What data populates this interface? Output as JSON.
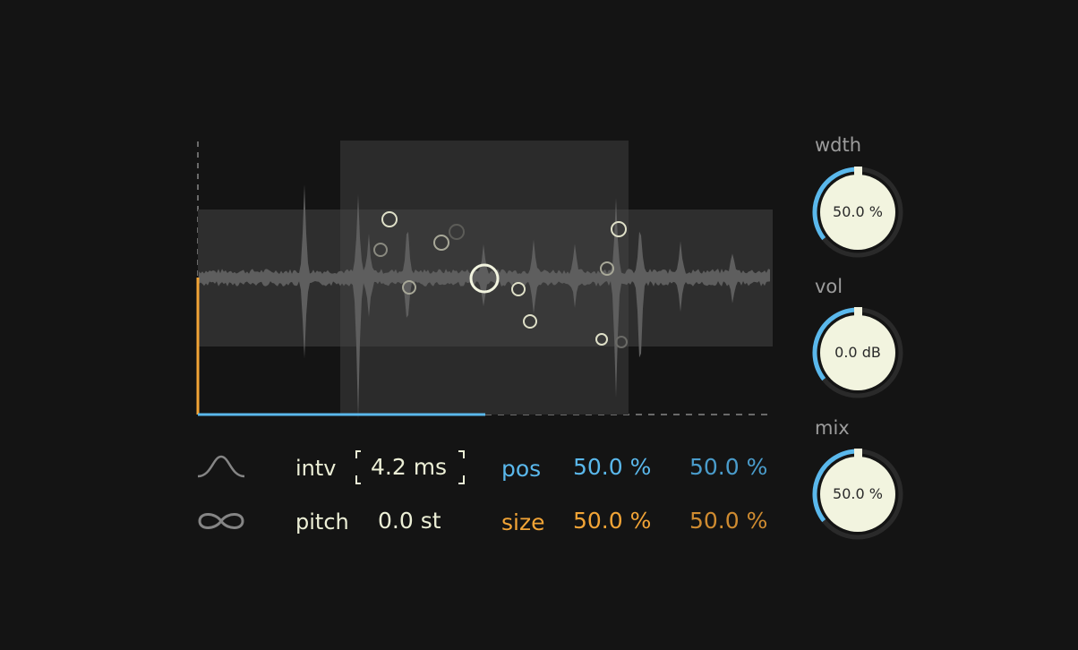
{
  "controls": {
    "interval": {
      "label": "intv",
      "value": "4.2 ms"
    },
    "pitch": {
      "label": "pitch",
      "value": "0.0 st"
    },
    "position": {
      "label": "pos",
      "value_a": "50.0 %",
      "value_b": "50.0 %"
    },
    "size": {
      "label": "size",
      "value_a": "50.0 %",
      "value_b": "50.0 %"
    }
  },
  "knobs": {
    "width": {
      "label": "wdth",
      "value": "50.0 %",
      "level": 0.5
    },
    "volume": {
      "label": "vol",
      "value": "0.0 dB",
      "level": 0.5
    },
    "mix": {
      "label": "mix",
      "value": "50.0 %",
      "level": 0.5
    }
  },
  "icons": {
    "envelope": "window-curve-icon",
    "loop": "infinity-loop-icon"
  },
  "colors": {
    "background": "#141414",
    "accent_blue": "#5ab8ec",
    "accent_orange": "#f2a436",
    "cream": "#f2f4df",
    "waveform": "#5e5e5e"
  }
}
